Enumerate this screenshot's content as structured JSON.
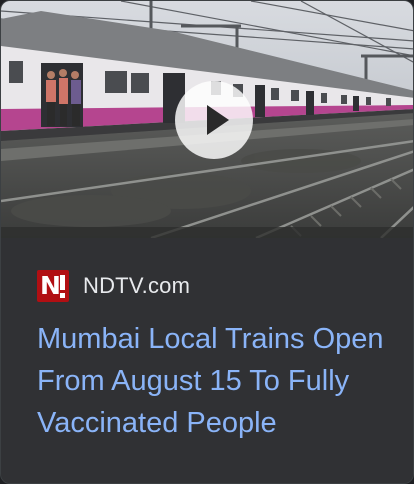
{
  "card": {
    "source": {
      "name": "NDTV.com",
      "logo_icon": "ndtv-logo-icon",
      "logo_color": "#b10f13"
    },
    "headline": "Mumbai Local Trains Open From August 15 To Fully Vaccinated People",
    "headline_color": "#8ab4f8",
    "thumbnail": {
      "description_icon": "train-thumbnail",
      "play_icon": "play-icon"
    }
  },
  "theme": {
    "card_bg": "#303134",
    "text": "#e8eaed"
  }
}
